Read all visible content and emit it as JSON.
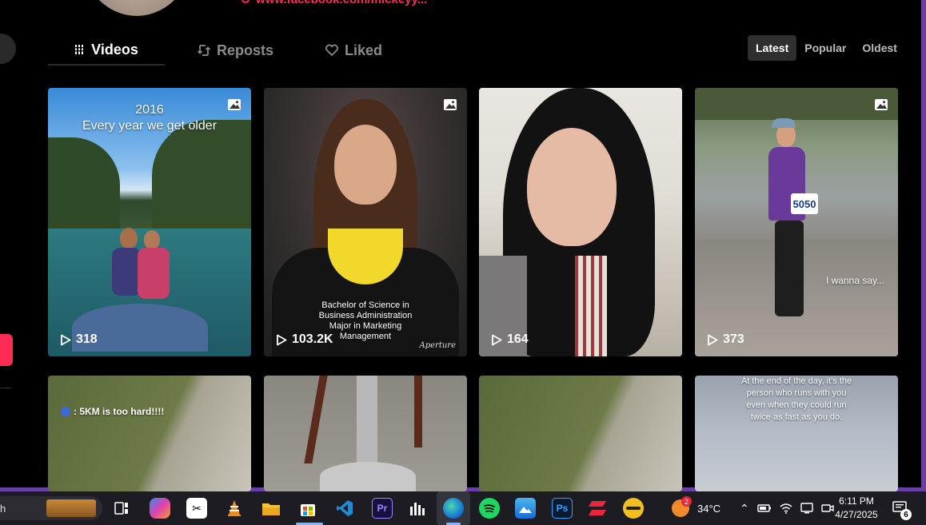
{
  "profile": {
    "link_text": "www.facebook.com/mickeyy..."
  },
  "tabs": [
    {
      "label": "Videos",
      "active": true
    },
    {
      "label": "Reposts",
      "active": false
    },
    {
      "label": "Liked",
      "active": false
    }
  ],
  "sort": [
    {
      "label": "Latest",
      "active": true
    },
    {
      "label": "Popular",
      "active": false
    },
    {
      "label": "Oldest",
      "active": false
    }
  ],
  "videos": [
    {
      "views": "318",
      "is_photo": true,
      "caption_line1": "2016",
      "caption_line2": "Every year we get older"
    },
    {
      "views": "103.2K",
      "is_photo": true,
      "caption_line1": "Bachelor of Science in",
      "caption_line2": "Business Administration",
      "caption_line3": "Major in Marketing",
      "caption_line4": "Management",
      "watermark": "Aperture"
    },
    {
      "views": "164",
      "is_photo": false
    },
    {
      "views": "373",
      "is_photo": true,
      "caption": "I wanna say...",
      "bib_number": "5050"
    },
    {
      "caption": ": 5KM is too hard!!!!"
    },
    {},
    {},
    {
      "caption_line1": "At the end of the day, it's the",
      "caption_line2": "person who runs with you",
      "caption_line3": "even when they could run",
      "caption_line4": "twice as fast as you do."
    }
  ],
  "taskbar": {
    "search_fragment": "h",
    "apps": [
      "task-view",
      "copilot",
      "capcut",
      "vlc",
      "file-explorer",
      "microsoft-store",
      "vscode",
      "premiere-pro",
      "audio-app",
      "edge",
      "spotify",
      "photos",
      "photoshop",
      "express",
      "app-yellow"
    ],
    "weather_badge": "2",
    "temperature": "34°C",
    "time": "6:11 PM",
    "date": "4/27/2025",
    "notification_count": "6"
  },
  "colors": {
    "accent": "#fe2c55",
    "frame": "#6b3fa0",
    "taskbar": "#1c1c22"
  }
}
